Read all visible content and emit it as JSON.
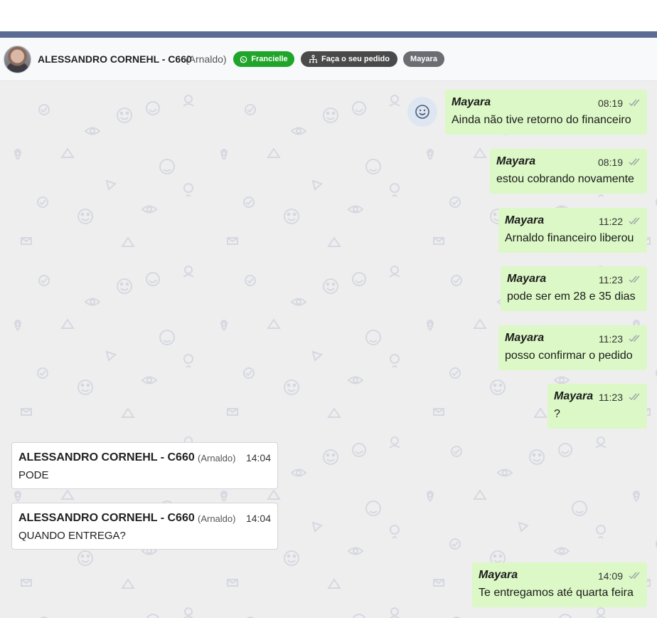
{
  "header": {
    "contact_name": "ALESSANDRO CORNEHL - C660",
    "contact_alias": "(Arnaldo)",
    "tags": [
      {
        "label": "Francielle",
        "icon": "whatsapp-icon"
      },
      {
        "label": "Faça o seu pedido",
        "icon": "flow-icon"
      },
      {
        "label": "Mayara"
      }
    ]
  },
  "colors": {
    "accent_strip": "#5b6b94",
    "outgoing_bubble": "#dcf8c6",
    "incoming_bubble": "#ffffff",
    "tag_green": "#1fa52a",
    "tag_dark": "#4a4a4a",
    "tag_gray": "#6c6c73"
  },
  "messages": [
    {
      "direction": "out",
      "sender": "Mayara",
      "time": "08:19",
      "text": "Ainda não tive retorno do financeiro",
      "status": "read"
    },
    {
      "direction": "out",
      "sender": "Mayara",
      "time": "08:19",
      "text": "estou cobrando novamente",
      "status": "read"
    },
    {
      "direction": "out",
      "sender": "Mayara",
      "time": "11:22",
      "text": "Arnaldo financeiro liberou",
      "status": "read"
    },
    {
      "direction": "out",
      "sender": "Mayara",
      "time": "11:23",
      "text": "pode ser em 28 e 35 dias",
      "status": "read"
    },
    {
      "direction": "out",
      "sender": "Mayara",
      "time": "11:23",
      "text": "posso confirmar o pedido",
      "status": "read"
    },
    {
      "direction": "out",
      "sender": "Mayara",
      "time": "11:23",
      "text": "?",
      "status": "read"
    },
    {
      "direction": "in",
      "sender": "ALESSANDRO CORNEHL - C660",
      "alias": "(Arnaldo)",
      "time": "14:04",
      "text": "PODE"
    },
    {
      "direction": "in",
      "sender": "ALESSANDRO CORNEHL - C660",
      "alias": "(Arnaldo)",
      "time": "14:04",
      "text": "QUANDO ENTREGA?"
    },
    {
      "direction": "out",
      "sender": "Mayara",
      "time": "14:09",
      "text": "Te entregamos até quarta feira",
      "status": "read"
    }
  ]
}
